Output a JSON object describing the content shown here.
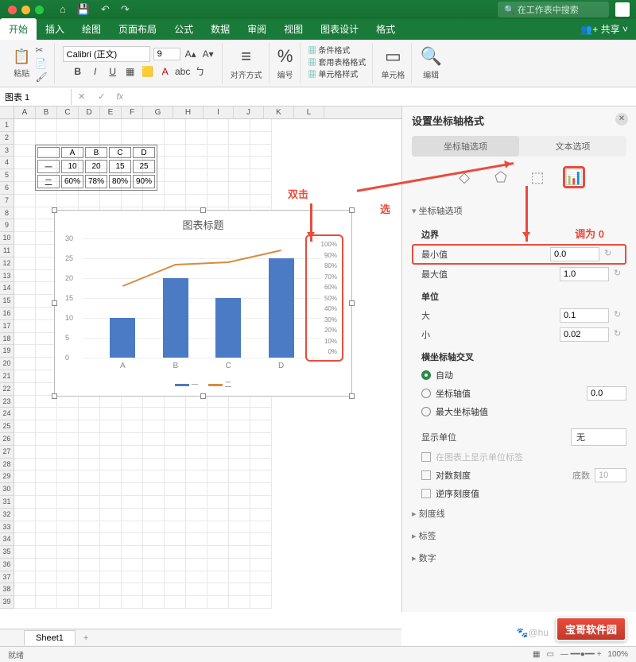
{
  "title_icons": [
    "🏠",
    "💾",
    "↶",
    "↷"
  ],
  "search_placeholder": "在工作表中搜索",
  "ribbon_tabs": [
    "开始",
    "插入",
    "绘图",
    "页面布局",
    "公式",
    "数据",
    "审阅",
    "视图",
    "图表设计",
    "格式"
  ],
  "share": "共享",
  "paste_label": "粘贴",
  "font_name": "Calibri (正文)",
  "font_size": "9",
  "align_label": "对齐方式",
  "number_label": "编号",
  "cond_items": [
    "条件格式",
    "套用表格格式",
    "单元格样式"
  ],
  "cells_label": "单元格",
  "edit_label": "编辑",
  "namebox": "图表 1",
  "table": {
    "headers": [
      "",
      "A",
      "B",
      "C",
      "D"
    ],
    "rows": [
      [
        "一",
        "10",
        "20",
        "15",
        "25"
      ],
      [
        "二",
        "60%",
        "78%",
        "80%",
        "90%"
      ]
    ]
  },
  "chart_data": {
    "type": "bar",
    "title": "图表标题",
    "categories": [
      "A",
      "B",
      "C",
      "D"
    ],
    "series": [
      {
        "name": "一",
        "type": "bar",
        "values": [
          10,
          20,
          15,
          25
        ]
      },
      {
        "name": "二",
        "type": "line",
        "values": [
          60,
          78,
          80,
          90
        ]
      }
    ],
    "y_primary_ticks": [
      0,
      5,
      10,
      15,
      20,
      25,
      30
    ],
    "y_secondary_ticks": [
      "100%",
      "90%",
      "80%",
      "70%",
      "60%",
      "50%",
      "40%",
      "30%",
      "20%",
      "10%",
      "0%"
    ],
    "ylim": [
      0,
      30
    ]
  },
  "annot": {
    "dblclick": "双击",
    "select": "选",
    "setzero": "调为 0"
  },
  "panel": {
    "title": "设置坐标轴格式",
    "tabs": [
      "坐标轴选项",
      "文本选项"
    ],
    "section_axis": "坐标轴选项",
    "bounds": "边界",
    "min": "最小值",
    "min_val": "0.0",
    "max": "最大值",
    "max_val": "1.0",
    "units": "单位",
    "major": "大",
    "major_val": "0.1",
    "minor": "小",
    "minor_val": "0.02",
    "cross": "横坐标轴交叉",
    "auto": "自动",
    "axis_val": "坐标轴值",
    "axis_val_v": "0.0",
    "max_axis": "最大坐标轴值",
    "disp_unit": "显示单位",
    "disp_unit_v": "无",
    "show_unit": "在图表上显示单位标签",
    "log": "对数刻度",
    "log_base": "底数",
    "log_base_v": "10",
    "reverse": "逆序刻度值",
    "ticks": "刻度线",
    "labels": "标签",
    "numbers": "数字"
  },
  "sheet_tab": "Sheet1",
  "status": "就绪",
  "zoom": "100%",
  "watermark": "宝哥软件园",
  "wm_user": "@hu"
}
